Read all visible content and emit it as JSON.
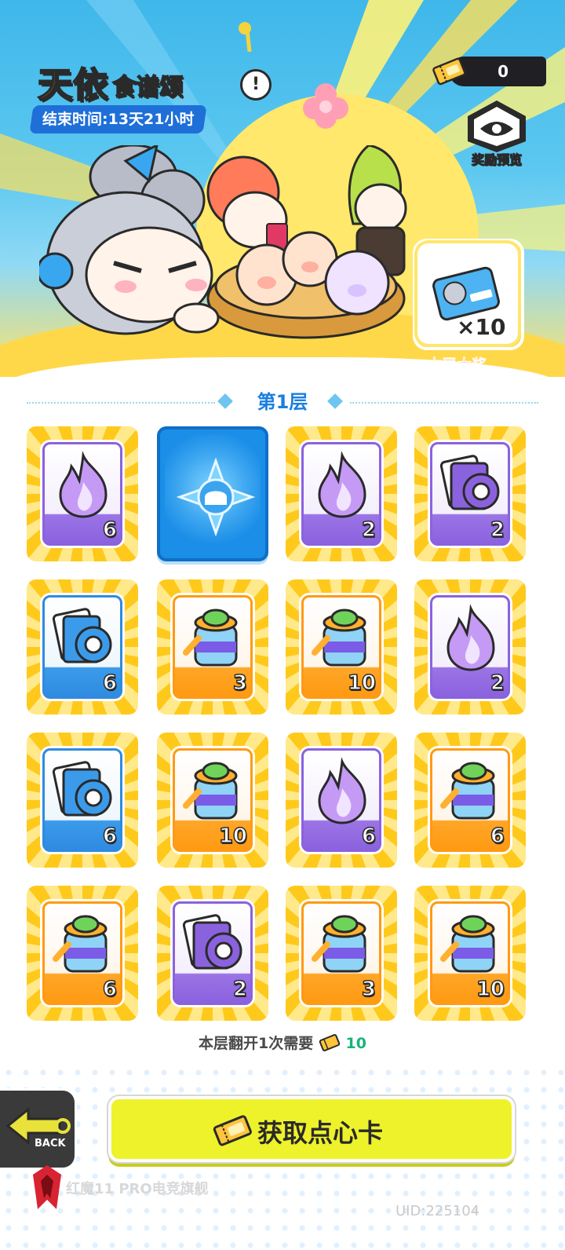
{
  "header": {
    "title_main": "天依",
    "title_sub": "食谱颂",
    "end_time": "结束时间:13天21小时",
    "currency_count": "0",
    "reward_preview_label": "奖励预览"
  },
  "grand_prize": {
    "card_text": "TIANYI",
    "quantity": "×10",
    "label": "本层大奖"
  },
  "layer": {
    "title": "第1层"
  },
  "grid": [
    {
      "type": "flame",
      "color": "purple",
      "count": "6"
    },
    {
      "type": "revealed",
      "color": "blue",
      "count": ""
    },
    {
      "type": "flame",
      "color": "purple",
      "count": "2"
    },
    {
      "type": "tape",
      "color": "purple",
      "count": "2"
    },
    {
      "type": "tape",
      "color": "blue",
      "count": "6"
    },
    {
      "type": "jar",
      "color": "orange",
      "count": "3"
    },
    {
      "type": "jar",
      "color": "orange",
      "count": "10"
    },
    {
      "type": "flame",
      "color": "purple",
      "count": "2"
    },
    {
      "type": "tape",
      "color": "blue",
      "count": "6"
    },
    {
      "type": "jar",
      "color": "orange",
      "count": "10"
    },
    {
      "type": "flame",
      "color": "purple",
      "count": "6"
    },
    {
      "type": "jar",
      "color": "orange",
      "count": "6"
    },
    {
      "type": "jar",
      "color": "orange",
      "count": "6"
    },
    {
      "type": "tape",
      "color": "purple",
      "count": "2"
    },
    {
      "type": "jar",
      "color": "orange",
      "count": "3"
    },
    {
      "type": "jar",
      "color": "orange",
      "count": "10"
    }
  ],
  "cost": {
    "text": "本层翻开1次需要",
    "value": "10"
  },
  "footer": {
    "back_label": "BACK",
    "main_button": "获取点心卡",
    "watermark": "红魔11 PRO电竞旗舰",
    "uid": "UID:225104"
  }
}
